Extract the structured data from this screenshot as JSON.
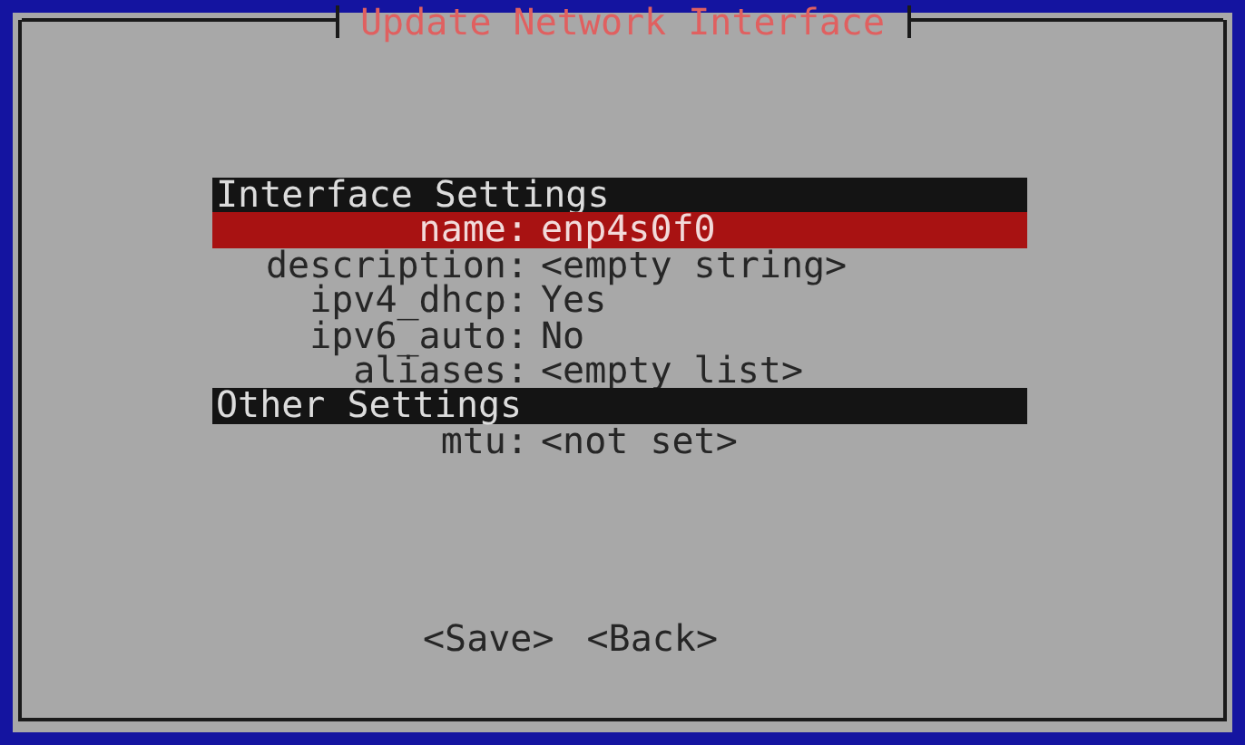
{
  "window": {
    "title": "Update Network Interface"
  },
  "sections": [
    {
      "title": "Interface Settings",
      "fields": [
        {
          "label": "name:",
          "value": "enp4s0f0",
          "selected": true
        },
        {
          "label": "description:",
          "value": "<empty string>",
          "selected": false
        },
        {
          "label": "ipv4_dhcp:",
          "value": "Yes",
          "selected": false
        },
        {
          "label": "ipv6_auto:",
          "value": "No",
          "selected": false
        },
        {
          "label": "aliases:",
          "value": "<empty list>",
          "selected": false
        }
      ]
    },
    {
      "title": "Other Settings",
      "fields": [
        {
          "label": "mtu:",
          "value": "<not set>",
          "selected": false
        }
      ]
    }
  ],
  "buttons": [
    {
      "label": "<Save>"
    },
    {
      "label": "<Back>"
    }
  ]
}
